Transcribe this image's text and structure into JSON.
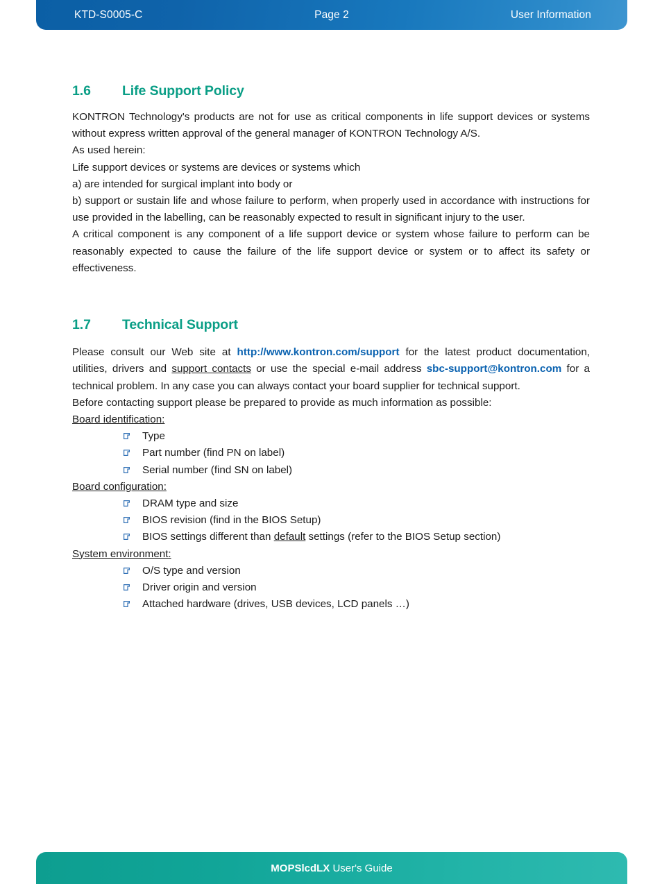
{
  "header": {
    "doc_id": "KTD-S0005-C",
    "page_label": "Page 2",
    "section_label": "User Information",
    "gradient_from": "#0b5fa5",
    "gradient_to": "#3d95d0"
  },
  "footer": {
    "product": "MOPSlcdLX",
    "suffix": " User's Guide",
    "color": "#11a598"
  },
  "theme": {
    "heading_color": "#0a9e86",
    "link_color": "#0a62b0",
    "bullet_color": "#2f6fb5",
    "body_color": "#1a1a1a"
  },
  "sections": [
    {
      "number": "1.6",
      "title": "Life Support Policy",
      "paragraphs": [
        "KONTRON Technology's products are not for use as critical components in life support devices or systems without express written approval of the general manager of KONTRON Technology A/S.",
        "As used herein:",
        "Life support devices or systems are devices or systems which",
        "a) are intended for surgical implant into body or",
        "b) support or sustain life and whose failure to perform, when properly used in accordance with instructions for use provided in the labelling, can be reasonably expected to result in significant injury to the user.",
        "A critical component is any component of a life support device or system whose failure to perform can be reasonably expected to cause the failure of the life support device or system or to affect its safety or effectiveness."
      ]
    },
    {
      "number": "1.7",
      "title": "Technical Support",
      "intro": {
        "part1": "Please consult our Web site at ",
        "web_link": "http://www.kontron.com/support",
        "part2": " for the latest product documentation, utilities, drivers and ",
        "support_contacts": "support contacts",
        "part3": " or use the special e-mail address ",
        "email_link": "sbc-support@kontron.com",
        "part4": " for a technical problem. In any case you can always contact your board supplier for technical support."
      },
      "before_contacting": "Before contacting support please be prepared to provide as much information as possible:",
      "groups": [
        {
          "label": "Board identification:",
          "items": [
            {
              "text": "Type"
            },
            {
              "text": "Part number (find PN on label)"
            },
            {
              "text": "Serial number (find SN on label)"
            }
          ]
        },
        {
          "label": "Board configuration:",
          "items": [
            {
              "text": "DRAM type and size"
            },
            {
              "text": "BIOS revision (find in the BIOS Setup)"
            },
            {
              "pre": "BIOS settings different than ",
              "underlined": "default",
              "post": " settings (refer to the BIOS Setup section)"
            }
          ]
        },
        {
          "label": "System environment:",
          "items": [
            {
              "text": "O/S type and version"
            },
            {
              "text": "Driver origin and version"
            },
            {
              "text": "Attached hardware (drives, USB devices, LCD panels …)"
            }
          ]
        }
      ]
    }
  ]
}
